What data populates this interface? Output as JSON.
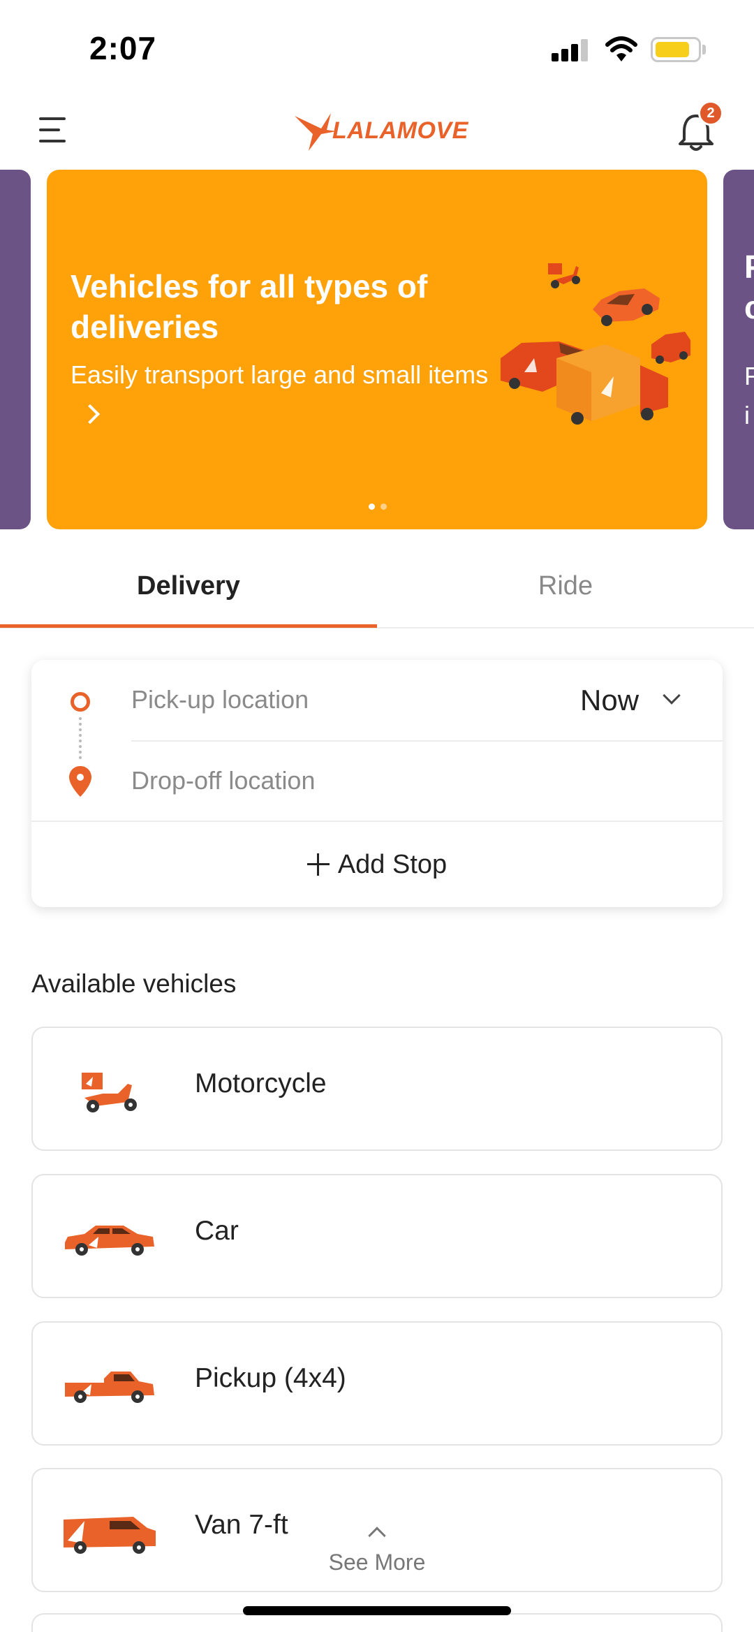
{
  "status_bar": {
    "time": "2:07"
  },
  "header": {
    "logo_text": "LALAMOVE",
    "notification_count": "2"
  },
  "banner": {
    "title": "Vehicles for all types of deliveries",
    "subtitle": "Easily transport large and small items",
    "page_count": 2,
    "active_page": 0,
    "peek_right_title": "P\nc",
    "peek_right_sub": "F\ni"
  },
  "tabs": [
    {
      "label": "Delivery",
      "active": true
    },
    {
      "label": "Ride",
      "active": false
    }
  ],
  "location": {
    "pickup_placeholder": "Pick-up location",
    "dropoff_placeholder": "Drop-off location",
    "time_selector": "Now",
    "add_stop": "Add Stop"
  },
  "vehicles": {
    "title": "Available vehicles",
    "items": [
      {
        "name": "Motorcycle",
        "icon": "motorcycle-icon"
      },
      {
        "name": "Car",
        "icon": "car-icon"
      },
      {
        "name": "Pickup (4x4)",
        "icon": "pickup-truck-icon"
      },
      {
        "name": "Van 7-ft",
        "icon": "van-icon"
      }
    ],
    "see_more": "See More"
  },
  "colors": {
    "brand_orange": "#e8622a",
    "banner_yellow": "#ffa20a",
    "peek_purple": "#6b5385"
  }
}
